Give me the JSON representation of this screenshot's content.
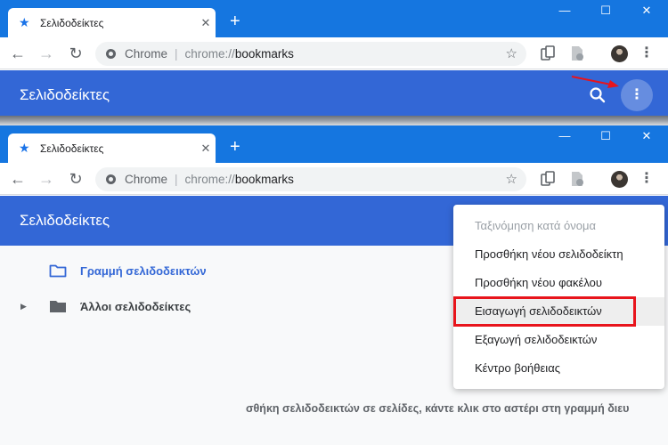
{
  "tab": {
    "title": "Σελιδοδείκτες",
    "close": "✕",
    "new_tab": "+"
  },
  "window_controls": {
    "minimize": "—",
    "maximize": "☐",
    "close": "✕"
  },
  "toolbar": {
    "back": "←",
    "forward": "→",
    "reload": "↻",
    "chrome_label": "Chrome",
    "separator": "|",
    "url_scheme": "chrome://",
    "url_host": "bookmarks",
    "star": "☆",
    "menu": "⋮"
  },
  "header": {
    "title": "Σελιδοδείκτες",
    "more": "⋮"
  },
  "tree": {
    "items": [
      {
        "label": "Γραμμή σελιδοδεικτών"
      },
      {
        "label": "Άλλοι σελιδοδείκτες",
        "caret": "▶"
      }
    ]
  },
  "dropdown": {
    "items": [
      {
        "label": "Ταξινόμηση κατά όνομα"
      },
      {
        "label": "Προσθήκη νέου σελιδοδείκτη"
      },
      {
        "label": "Προσθήκη νέου φακέλου"
      },
      {
        "label": "Εισαγωγή σελιδοδεικτών"
      },
      {
        "label": "Εξαγωγή σελιδοδεικτών"
      },
      {
        "label": "Κέντρο βοήθειας"
      }
    ]
  },
  "hint_text": "σθήκη σελιδοδεικτών σε σελίδες, κάντε κλικ στο αστέρι στη γραμμή διευ",
  "colors": {
    "titlebar": "#1576e0",
    "header": "#3367d6",
    "highlight": "#e8141c",
    "arrow": "#e8141c"
  }
}
